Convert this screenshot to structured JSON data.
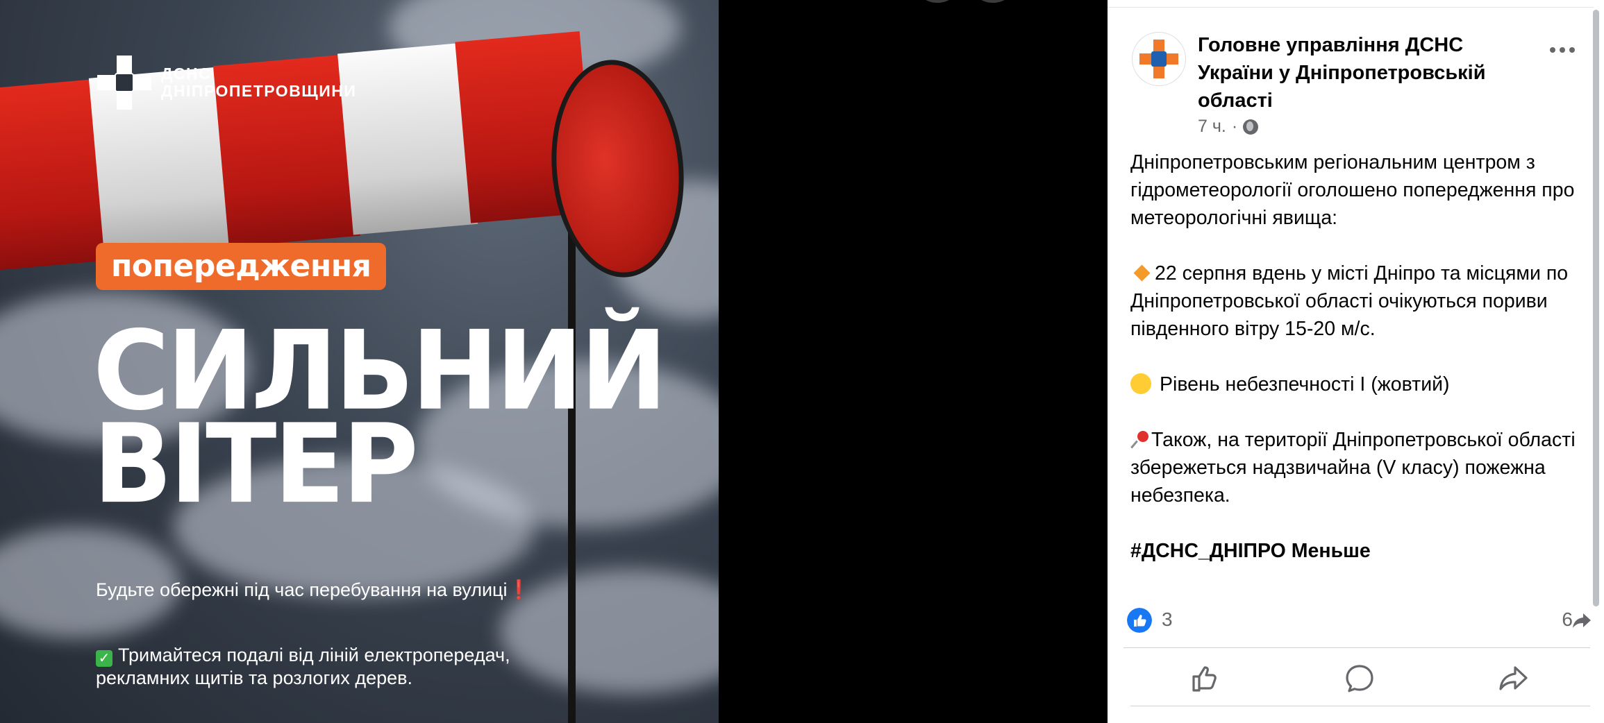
{
  "photo": {
    "logo_line1": "ДСНС",
    "logo_line2": "ДНІПРОПЕТРОВЩИНИ",
    "badge": "попередження",
    "headline_line1": "СИЛЬНИЙ",
    "headline_line2": "ВІТЕР",
    "advice1": "Будьте обережні під час перебування на вулиці",
    "advice1_mark": "❗",
    "advice2": "Тримайтеся подалі від ліній електропередач, рекламних щитів та розлогих дерев.",
    "advice2_mark": "✓"
  },
  "post": {
    "author": "Головне управління ДСНС України у Дніпропетровській області",
    "time": "7 ч.",
    "separator": "·",
    "paragraph1": "Дніпропетровським регіональним центром з гідрометеорології оголошено попередження про метеорологічні явища:",
    "paragraph2": "22 серпня вдень у місті Дніпро та місцями по Дніпропетровської області очікуються пориви південного вітру 15-20 м/с.",
    "paragraph3": "Рівень небезпечності І (жовтий)",
    "paragraph4": "Також, на території Дніпропетровської області збережеться надзвичайна (V класу) пожежна небезпека.",
    "hashtag": "#ДСНС_ДНІПРО",
    "see_less": "Меньше",
    "reactions_count": "3",
    "shares_count": "6"
  },
  "colors": {
    "badge_orange": "#ef6b2c",
    "facebook_blue": "#1877f2",
    "sock_red": "#e22a1d"
  },
  "icons": [
    "ellipsis-icon",
    "globe-icon",
    "like-icon",
    "comment-icon",
    "share-icon",
    "diamond-icon",
    "yellow-circle-icon",
    "pin-icon",
    "checkmark-icon"
  ]
}
